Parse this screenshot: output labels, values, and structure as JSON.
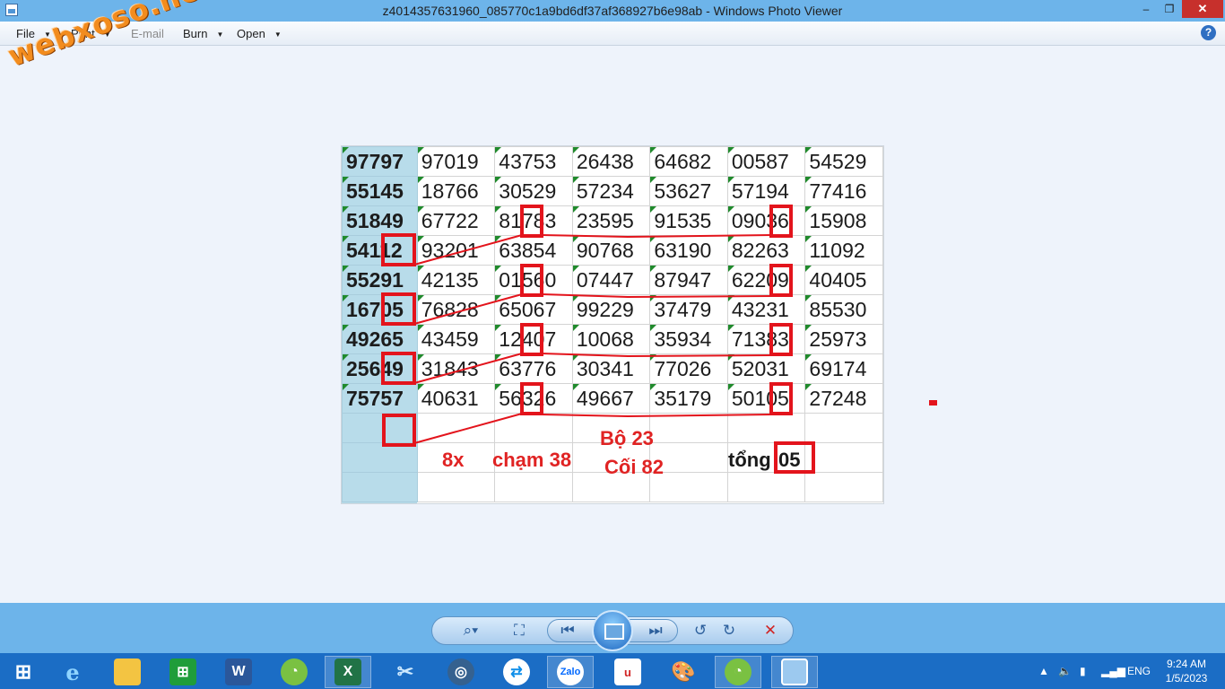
{
  "window": {
    "title": "z4014357631960_085770c1a9bd6df37af368927b6e98ab - Windows Photo Viewer",
    "min_glyph": "–",
    "max_glyph": "❐",
    "close_glyph": "✕"
  },
  "menu": {
    "items": [
      {
        "label": "File"
      },
      {
        "label": "Print"
      },
      {
        "label": "E-mail"
      },
      {
        "label": "Burn"
      },
      {
        "label": "Open"
      }
    ],
    "help_glyph": "?"
  },
  "watermark": "webxoso.net",
  "table": {
    "rows": [
      [
        "97797",
        "97019",
        "43753",
        "26438",
        "64682",
        "00587",
        "54529"
      ],
      [
        "55145",
        "18766",
        "30529",
        "57234",
        "53627",
        "57194",
        "77416"
      ],
      [
        "51849",
        "67722",
        "81783",
        "23595",
        "91535",
        "09036",
        "15908"
      ],
      [
        "54112",
        "93201",
        "63854",
        "90768",
        "63190",
        "82263",
        "11092"
      ],
      [
        "55291",
        "42135",
        "01560",
        "07447",
        "87947",
        "62209",
        "40405"
      ],
      [
        "16705",
        "76828",
        "65067",
        "99229",
        "37479",
        "43231",
        "85530"
      ],
      [
        "49265",
        "43459",
        "12407",
        "10068",
        "35934",
        "71383",
        "25973"
      ],
      [
        "25649",
        "31843",
        "63776",
        "30341",
        "77026",
        "52031",
        "69174"
      ],
      [
        "75757",
        "40631",
        "56326",
        "49667",
        "35179",
        "50105",
        "27248"
      ]
    ]
  },
  "annotations": {
    "note_8x": "8x",
    "note_cham": "chạm 38",
    "note_bo": "Bộ 23",
    "note_coi": "Cối 82",
    "note_tong": "tổng",
    "note_tong_value": "05"
  },
  "taskbar": {
    "tray_lang": "ENG",
    "clock_time": "9:24 AM",
    "clock_date": "1/5/2023",
    "icons": [
      "windows-start-icon",
      "internet-explorer-icon",
      "file-explorer-icon",
      "store-icon",
      "word-icon",
      "coccoc-icon",
      "excel-icon",
      "snipping-icon",
      "media-player-icon",
      "teamviewer-icon",
      "zalo-icon",
      "unikey-icon",
      "paint-icon",
      "coccoc-browser-icon",
      "photo-viewer-icon"
    ],
    "zalo_label": "Zalo"
  },
  "colors": {
    "accent": "#6db4ea",
    "taskbar": "#1b6dc5",
    "highlight": "#e02323"
  }
}
